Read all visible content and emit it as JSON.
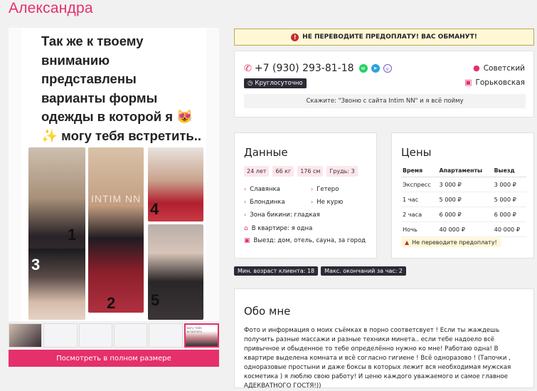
{
  "profile": {
    "name": "Александра"
  },
  "gallery": {
    "caption_lines": [
      "Так же к твоему",
      "вниманию",
      "представлены",
      "варианты формы",
      "одежды в которой я 😻",
      "✨ могу тебя встретить.."
    ],
    "numbers": [
      "1",
      "2",
      "3",
      "4",
      "5"
    ],
    "watermark": "INTIM NN",
    "prev_arrow": "‹",
    "next_arrow": "›",
    "thumb_texts": [
      "",
      "",
      "",
      "",
      "",
      "могу тебя встретить"
    ],
    "full_size_button": "Посмотреть в полном размере"
  },
  "warning_banner": "НЕ ПЕРЕВОДИТЕ ПРЕДОПЛАТУ! ВАС ОБМАНУТ!",
  "contact": {
    "phone": "+7 (930) 293-81-18",
    "messengers": [
      "whatsapp-icon",
      "telegram-icon",
      "viber-icon"
    ],
    "hours_badge": "Круглосуточно",
    "district": "Советский",
    "metro": "Горьковская",
    "say_text": "Скажите: \"Звоню с сайта Intim NN\" и я всё пойму"
  },
  "data_section": {
    "title": "Данные",
    "tags": [
      "24 лет",
      "66 кг",
      "176 см",
      "Грудь: 3"
    ],
    "traits": [
      [
        "Славянка",
        "Гетеро"
      ],
      [
        "Блондинка",
        "Не курю"
      ],
      [
        "Зона бикини: гладкая",
        ""
      ]
    ],
    "in_apartment": "В квартире: я одна",
    "outcall": "Выезд: дом, отель, сауна, за город"
  },
  "prices": {
    "title": "Цены",
    "columns": [
      "Время",
      "Апартаменты",
      "Выезд"
    ],
    "rows": [
      [
        "Экспресс",
        "3 000 ₽",
        "3 000 ₽"
      ],
      [
        "1 час",
        "5 000 ₽",
        "5 000 ₽"
      ],
      [
        "2 часа",
        "6 000 ₽",
        "6 000 ₽"
      ],
      [
        "Ночь",
        "40 000 ₽",
        "40 000 ₽"
      ]
    ],
    "warning": "Не переводите предоплату!"
  },
  "chips": [
    "Мин. возраст клиента: 18",
    "Макс. окончаний за час: 2"
  ],
  "about": {
    "title": "Обо мне",
    "text": "Фото и информация о моих съёмках в порно соответсвует ! Если ты жаждешь получить разные массажи и разные техники минета.. если тебе надоело всё привычное и обыденное то тебе определённо нужно ко мне! Работаю одна! В квартире выделена комната и всё согласно гигиене ! Всё одноразово ! (Тапочки , одноразовые простыни и даже боксы в которых лежит вся необходимая мужская косметика ) я люблю свою работу! И ценю каждого уважаемого и самое главное АДЕКВАТНОГО ГОСТЯ!))"
  },
  "colors": {
    "accent": "#e5306b",
    "dark_badge": "#2b2b36",
    "warning_bg": "#fff7d6"
  }
}
